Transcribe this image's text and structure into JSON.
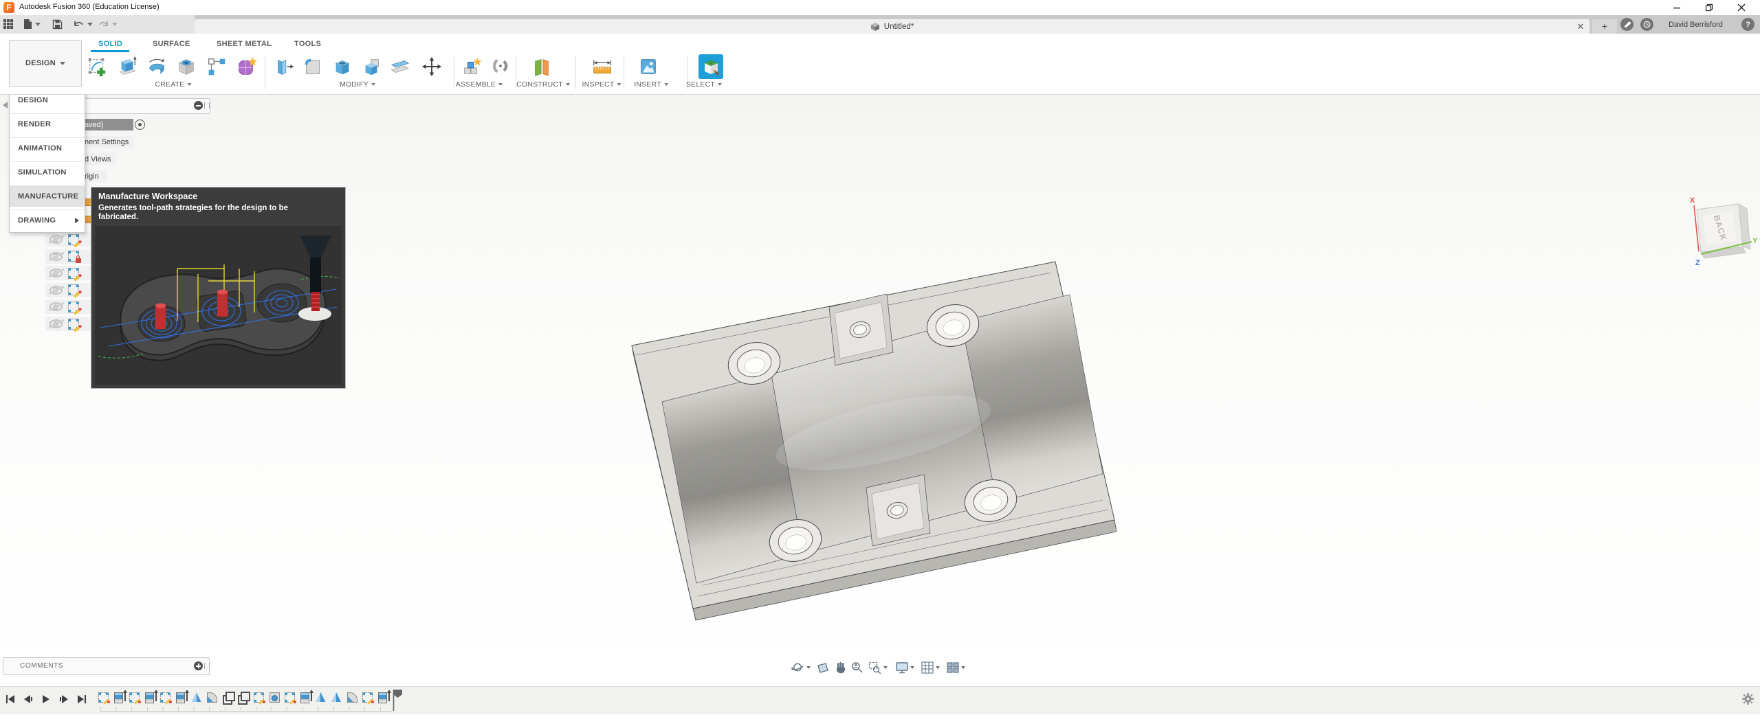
{
  "titlebar": {
    "title": "Autodesk Fusion 360 (Education License)"
  },
  "appbar": {
    "document_tab": "Untitled*",
    "user_name": "David Berrisford"
  },
  "ribbon": {
    "workspace_selector": "DESIGN",
    "tabs": [
      "SOLID",
      "SURFACE",
      "SHEET METAL",
      "TOOLS"
    ],
    "active_tab": "SOLID",
    "groups": {
      "create": "CREATE",
      "modify": "MODIFY",
      "assemble": "ASSEMBLE",
      "construct": "CONSTRUCT",
      "inspect": "INSPECT",
      "insert": "INSERT",
      "select": "SELECT"
    }
  },
  "workspace_menu": {
    "items": [
      {
        "label": "DESIGN",
        "highlighted": false
      },
      {
        "label": "RENDER",
        "highlighted": false
      },
      {
        "label": "ANIMATION",
        "highlighted": false
      },
      {
        "label": "SIMULATION",
        "highlighted": false
      },
      {
        "label": "MANUFACTURE",
        "highlighted": true
      },
      {
        "label": "DRAWING",
        "highlighted": false,
        "has_submenu": true
      }
    ]
  },
  "manufacture_tooltip": {
    "title": "Manufacture Workspace",
    "line1": "Generates tool-path strategies for the design to be",
    "line2": "fabricated."
  },
  "browser": {
    "visible_row_fragments": [
      {
        "fragment": "aved)",
        "selected": true
      },
      {
        "fragment": "nent Settings",
        "selected": false
      },
      {
        "fragment": "d Views",
        "selected": false
      },
      {
        "fragment": "rigin",
        "selected": false
      }
    ],
    "sketch_rows": [
      "pencil",
      "lock",
      "pencil",
      "pencil",
      "pencil",
      "pencil"
    ]
  },
  "viewcube": {
    "face": "BACK",
    "axis_x": "X",
    "axis_y": "Y",
    "axis_z": "Z"
  },
  "comments": {
    "label": "COMMENTS"
  },
  "timeline": {
    "features": [
      "sketch",
      "extrude",
      "sketch",
      "extrude",
      "sketch",
      "extrude",
      "mirror",
      "fillet",
      "pattern",
      "pattern",
      "sketch",
      "hole",
      "sketch",
      "extrude",
      "mirror",
      "mirror",
      "fillet",
      "sketch",
      "extrude"
    ]
  },
  "colors": {
    "accent_blue": "#0a99d4",
    "select_icon_bg": "#1e9fd8",
    "tooltip_bg": "#3c3c3c",
    "timeline_blue": "#4796cf",
    "axis_x_red": "#e05348",
    "axis_y_green": "#7cc043",
    "axis_z_blue": "#4a6fe0"
  }
}
